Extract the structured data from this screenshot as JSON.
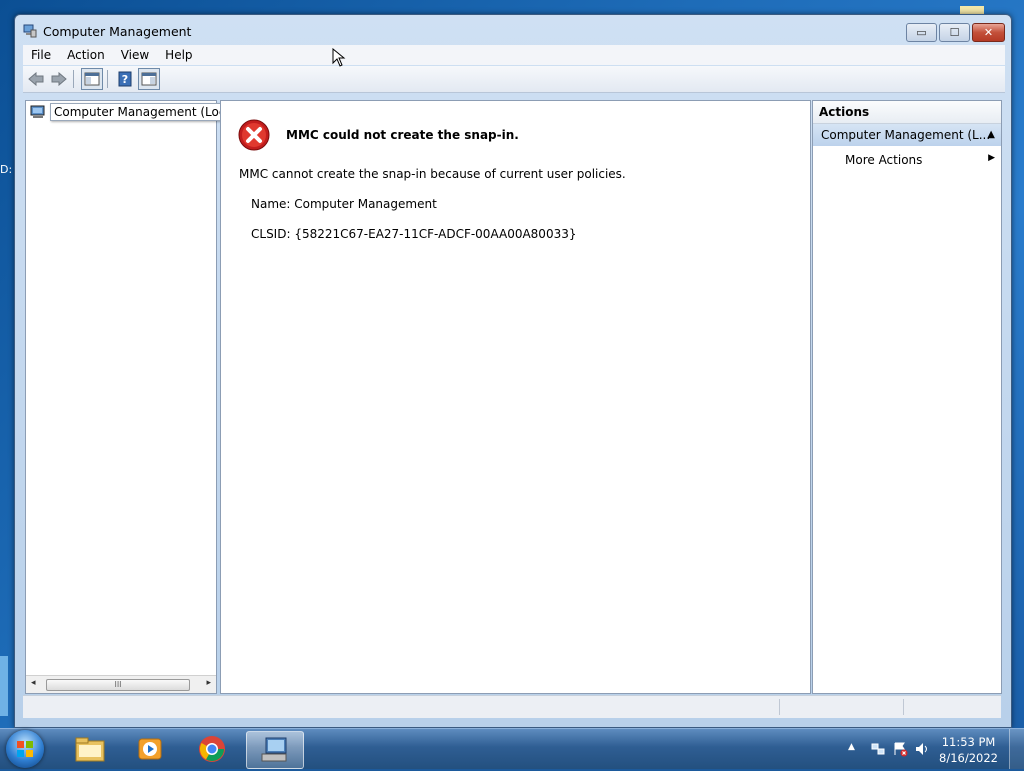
{
  "window": {
    "title": "Computer Management",
    "caption": {
      "minimize_glyph": "▭",
      "maximize_glyph": "☐",
      "close_glyph": "✕"
    }
  },
  "menu": {
    "items": [
      {
        "label": "File"
      },
      {
        "label": "Action"
      },
      {
        "label": "View"
      },
      {
        "label": "Help"
      }
    ]
  },
  "toolbar": {
    "buttons": [
      "back-icon",
      "forward-icon",
      "show-hide-console-tree-icon",
      "help-icon",
      "show-hide-action-pane-icon"
    ]
  },
  "tree": {
    "root_label": "Computer Management (Local"
  },
  "error": {
    "title": "MMC could not create the snap-in.",
    "message": "MMC cannot create the snap-in because of current user policies.",
    "name": "Name: Computer Management",
    "clsid": "CLSID: {58221C67-EA27-11CF-ADCF-00AA00A80033}"
  },
  "actions": {
    "header": "Actions",
    "selected": "Computer Management (L...",
    "more": "More Actions"
  },
  "scroll": {
    "thumb_grip": "III"
  },
  "taskbar": {
    "apps": [
      "explorer-icon",
      "media-player-icon",
      "chrome-icon",
      "computer-management-icon"
    ],
    "time": "11:53 PM",
    "date": "8/16/2022"
  },
  "desktop": {
    "edge_text": "D:"
  }
}
